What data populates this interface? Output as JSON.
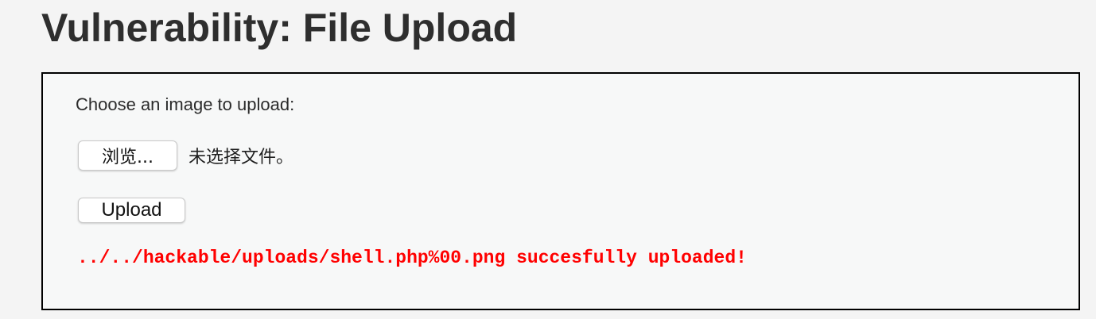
{
  "page": {
    "title": "Vulnerability: File Upload"
  },
  "upload_form": {
    "prompt": "Choose an image to upload:",
    "browse_label": "浏览...",
    "file_status": "未选择文件。",
    "upload_label": "Upload",
    "result_message": "../../hackable/uploads/shell.php%00.png succesfully uploaded!"
  },
  "colors": {
    "background": "#f4f4f4",
    "box_background": "#f7f8f8",
    "box_border": "#000000",
    "error_text": "#ff0000"
  }
}
